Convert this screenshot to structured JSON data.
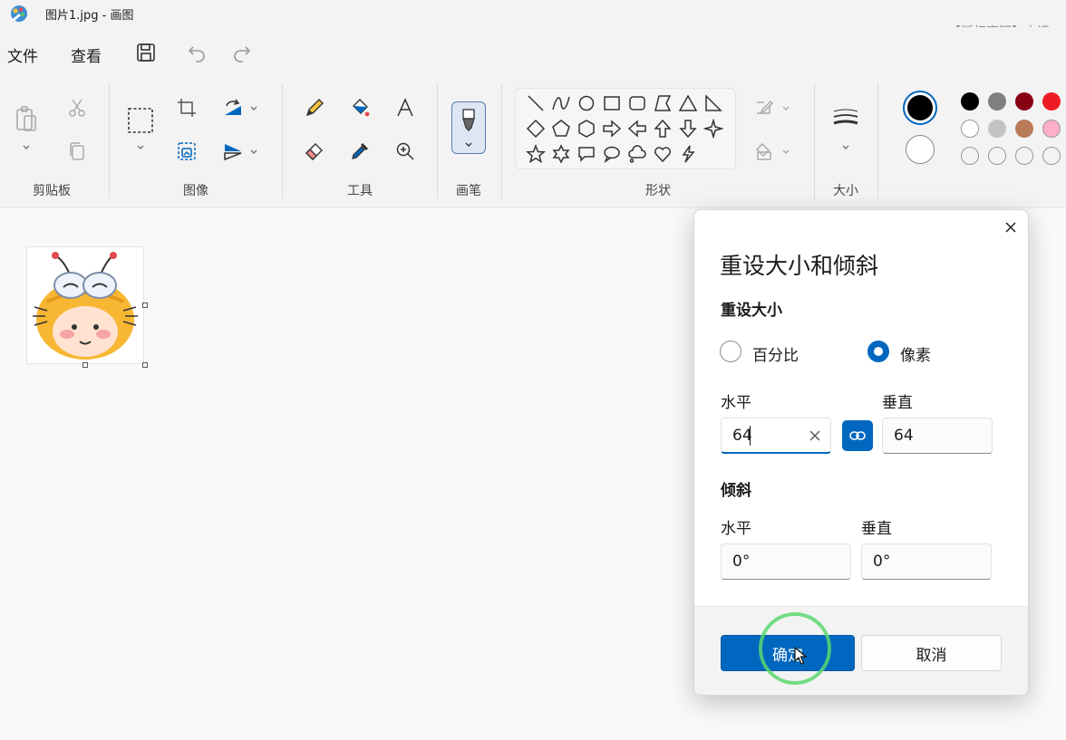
{
  "window": {
    "title": "图片1.jpg - 画图",
    "watermark": "【版权声明】本课"
  },
  "menu": {
    "file": "文件",
    "view": "查看"
  },
  "ribbon": {
    "groups": {
      "clipboard": "剪贴板",
      "image": "图像",
      "tools": "工具",
      "brushes": "画笔",
      "shapes": "形状",
      "size": "大小"
    }
  },
  "colors": {
    "accent": "#0067c0",
    "primary_color": "#000000",
    "secondary_color": "#ffffff",
    "palette_row1": [
      "#000000",
      "#7f7f7f",
      "#880015",
      "#ed1c24"
    ],
    "palette_row2": [
      "#ffffff",
      "#c3c3c3",
      "#b97a57",
      "#ffaec9"
    ],
    "palette_row3": [
      "empty",
      "empty",
      "empty",
      "empty"
    ]
  },
  "dialog": {
    "title": "重设大小和倾斜",
    "resize": {
      "heading": "重设大小",
      "option_percent": "百分比",
      "option_pixels": "像素",
      "selected": "像素",
      "horizontal_label": "水平",
      "vertical_label": "垂直",
      "horizontal_value": "64",
      "vertical_value": "64",
      "maintain_aspect_ratio": true
    },
    "skew": {
      "heading": "倾斜",
      "horizontal_label": "水平",
      "vertical_label": "垂直",
      "horizontal_value": "0°",
      "vertical_value": "0°"
    },
    "ok": "确定",
    "cancel": "取消"
  }
}
